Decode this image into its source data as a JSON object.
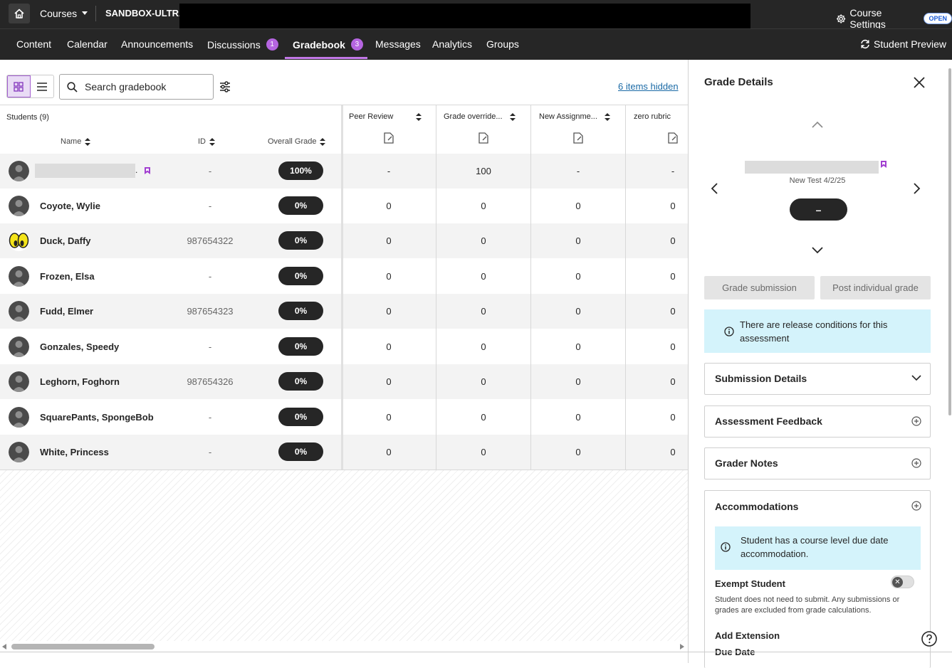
{
  "topbar": {
    "courses_label": "Courses",
    "course_title": "SANDBOX-ULTRA",
    "settings_label": "Course Settings",
    "settings_badge": "OPEN"
  },
  "nav": {
    "items": [
      {
        "label": "Content"
      },
      {
        "label": "Calendar"
      },
      {
        "label": "Announcements"
      },
      {
        "label": "Discussions",
        "badge": "1"
      },
      {
        "label": "Gradebook",
        "badge": "3"
      },
      {
        "label": "Messages"
      },
      {
        "label": "Analytics"
      },
      {
        "label": "Groups"
      }
    ],
    "student_preview": "Student Preview"
  },
  "toolbar": {
    "search_placeholder": "Search gradebook",
    "items_hidden": "6 items hidden"
  },
  "grid": {
    "students_header": "Students (9)",
    "col_name": "Name",
    "col_id": "ID",
    "col_overall": "Overall Grade",
    "item_columns": [
      "Peer Review",
      "Grade override...",
      "New Assignme...",
      "zero rubric"
    ],
    "rows": [
      {
        "name": "",
        "id": "-",
        "overall": "100%",
        "cells": [
          "-",
          "100",
          "-",
          "-"
        ]
      },
      {
        "name": "Coyote, Wylie",
        "id": "-",
        "overall": "0%",
        "cells": [
          "0",
          "0",
          "0",
          "0"
        ]
      },
      {
        "name": "Duck, Daffy",
        "id": "987654322",
        "overall": "0%",
        "cells": [
          "0",
          "0",
          "0",
          "0"
        ]
      },
      {
        "name": "Frozen, Elsa",
        "id": "-",
        "overall": "0%",
        "cells": [
          "0",
          "0",
          "0",
          "0"
        ]
      },
      {
        "name": "Fudd, Elmer",
        "id": "987654323",
        "overall": "0%",
        "cells": [
          "0",
          "0",
          "0",
          "0"
        ]
      },
      {
        "name": "Gonzales, Speedy",
        "id": "-",
        "overall": "0%",
        "cells": [
          "0",
          "0",
          "0",
          "0"
        ]
      },
      {
        "name": "Leghorn, Foghorn",
        "id": "987654326",
        "overall": "0%",
        "cells": [
          "0",
          "0",
          "0",
          "0"
        ]
      },
      {
        "name": "SquarePants, SpongeBob",
        "id": "-",
        "overall": "0%",
        "cells": [
          "0",
          "0",
          "0",
          "0"
        ]
      },
      {
        "name": "White, Princess",
        "id": "-",
        "overall": "0%",
        "cells": [
          "0",
          "0",
          "0",
          "0"
        ]
      }
    ]
  },
  "panel": {
    "title": "Grade Details",
    "test_name": "New Test 4/2/25",
    "grade_value": "–",
    "grade_submission": "Grade submission",
    "post_individual": "Post individual grade",
    "release_info": "There are release conditions for this assessment",
    "submission_details": "Submission Details",
    "assessment_feedback": "Assessment Feedback",
    "grader_notes": "Grader Notes",
    "accommodations": "Accommodations",
    "accommodation_info": "Student has a course level due date accommodation.",
    "exempt_label": "Exempt Student",
    "exempt_desc": "Student does not need to submit. Any submissions or grades are excluded from grade calculations.",
    "add_extension": "Add Extension",
    "due_date": "Due Date"
  },
  "colors": {
    "accent": "#b565e0",
    "topbar": "#262626",
    "info_bg": "#d4f3fb"
  }
}
